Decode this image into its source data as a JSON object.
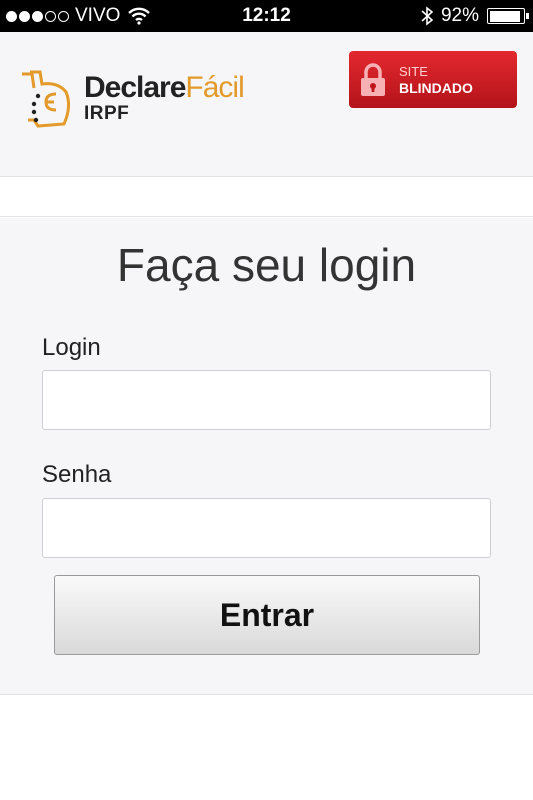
{
  "status_bar": {
    "carrier": "VIVO",
    "time": "12:12",
    "battery": "92%",
    "battery_level": 0.92,
    "signal_bars": 3,
    "signal_total": 5
  },
  "header": {
    "logo": {
      "brand_part1": "Declare",
      "brand_part2": "Fácil",
      "sub": "IRPF"
    },
    "badge": {
      "line1": "SITE",
      "line2": "BLINDADO"
    }
  },
  "login": {
    "title": "Faça seu login",
    "login_label": "Login",
    "login_value": "",
    "senha_label": "Senha",
    "senha_value": "",
    "submit_label": "Entrar"
  },
  "colors": {
    "brand_orange": "#e39a2a",
    "badge_red": "#d2161d",
    "panel_bg": "#f6f6f8"
  }
}
